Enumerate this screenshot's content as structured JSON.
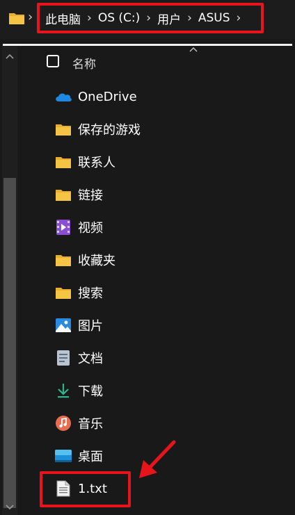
{
  "breadcrumb": {
    "items": [
      "此电脑",
      "OS (C:)",
      "用户",
      "ASUS"
    ]
  },
  "list": {
    "header_label": "名称",
    "items": [
      {
        "label": "OneDrive",
        "icon": "onedrive-cloud-icon"
      },
      {
        "label": "保存的游戏",
        "icon": "folder-icon"
      },
      {
        "label": "联系人",
        "icon": "folder-icon"
      },
      {
        "label": "链接",
        "icon": "folder-icon"
      },
      {
        "label": "视频",
        "icon": "videos-icon"
      },
      {
        "label": "收藏夹",
        "icon": "folder-icon"
      },
      {
        "label": "搜索",
        "icon": "folder-icon"
      },
      {
        "label": "图片",
        "icon": "pictures-icon"
      },
      {
        "label": "文档",
        "icon": "documents-icon"
      },
      {
        "label": "下载",
        "icon": "download-icon"
      },
      {
        "label": "音乐",
        "icon": "music-icon"
      },
      {
        "label": "桌面",
        "icon": "desktop-icon"
      },
      {
        "label": "1.txt",
        "icon": "text-file-icon"
      }
    ]
  },
  "colors": {
    "background": "#191919",
    "highlight_box": "#e8141c",
    "folder_yellow": "#f6c445",
    "onedrive_blue": "#1f88e0"
  }
}
